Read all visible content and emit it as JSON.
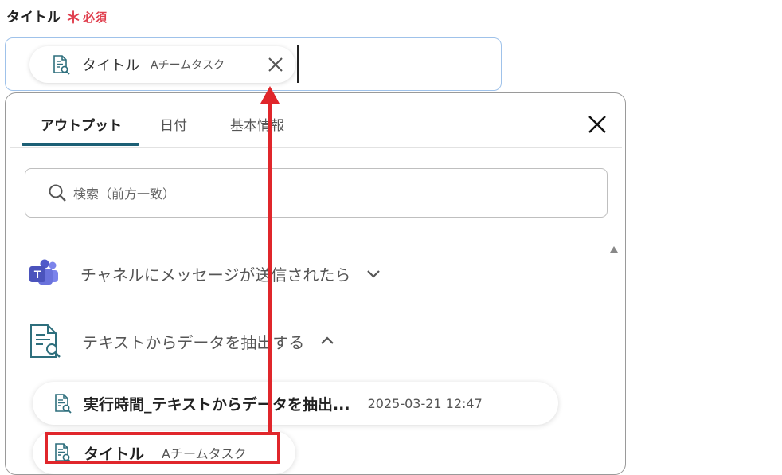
{
  "field": {
    "label": "タイトル",
    "required_mark": "＊",
    "required_text": "必須",
    "chip_name": "タイトル",
    "chip_sub": "Aチームタスク"
  },
  "panel": {
    "tabs": [
      {
        "label": "アウトプット",
        "active": true
      },
      {
        "label": "日付",
        "active": false
      },
      {
        "label": "基本情報",
        "active": false
      }
    ],
    "search": {
      "placeholder": "検索（前方一致）",
      "value": ""
    },
    "groups": [
      {
        "title": "チャネルにメッセージが送信されたら",
        "icon": "teams-icon",
        "expanded": false
      },
      {
        "title": "テキストからデータを抽出する",
        "icon": "document-search-icon",
        "expanded": true
      }
    ],
    "outputs": [
      {
        "name": "実行時間_テキストからデータを抽出...",
        "value": "2025-03-21 12:47"
      },
      {
        "name": "タイトル",
        "value": "Aチームタスク"
      }
    ]
  },
  "colors": {
    "accent": "#1c5f75",
    "required": "#e0404f",
    "annotation": "#e0262b",
    "field_border": "#9fc2ea",
    "teams_purple": "#5059c9"
  }
}
